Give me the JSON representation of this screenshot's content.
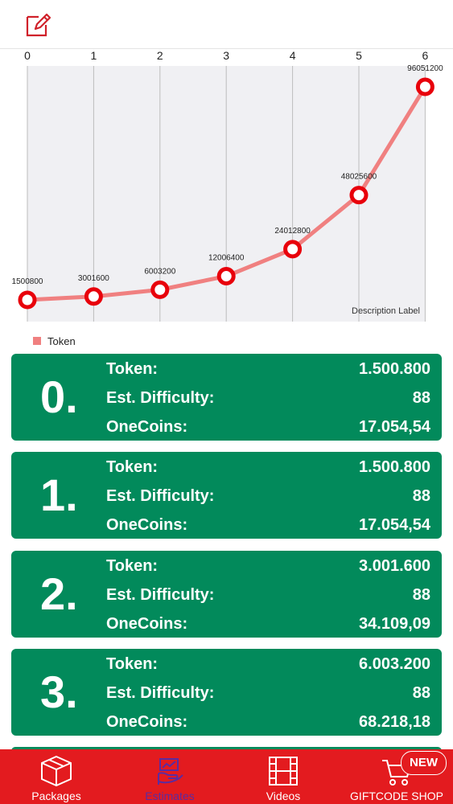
{
  "header": {
    "edit_icon": "edit-icon"
  },
  "chart_data": {
    "type": "line",
    "x": [
      0,
      1,
      2,
      3,
      4,
      5,
      6
    ],
    "series": [
      {
        "name": "Token",
        "values": [
          1500800,
          3001600,
          6003200,
          12006400,
          24012800,
          48025600,
          96051200
        ],
        "point_labels": [
          "1500800",
          "3001600",
          "6003200",
          "12006400",
          "24012800",
          "48025600",
          "96051200"
        ]
      }
    ],
    "tick_labels": [
      "0",
      "1",
      "2",
      "3",
      "4",
      "5",
      "6"
    ],
    "description": "Description Label",
    "legend": "bottom-left",
    "grid": true,
    "colors": {
      "line": "#f08080",
      "marker": "#e8000b"
    }
  },
  "cards": [
    {
      "index": "0.",
      "token_label": "Token:",
      "token": "1.500.800",
      "difficulty_label": "Est. Difficulty:",
      "difficulty": "88",
      "onecoins_label": "OneCoins:",
      "onecoins": "17.054,54"
    },
    {
      "index": "1.",
      "token_label": "Token:",
      "token": "1.500.800",
      "difficulty_label": "Est. Difficulty:",
      "difficulty": "88",
      "onecoins_label": "OneCoins:",
      "onecoins": "17.054,54"
    },
    {
      "index": "2.",
      "token_label": "Token:",
      "token": "3.001.600",
      "difficulty_label": "Est. Difficulty:",
      "difficulty": "88",
      "onecoins_label": "OneCoins:",
      "onecoins": "34.109,09"
    },
    {
      "index": "3.",
      "token_label": "Token:",
      "token": "6.003.200",
      "difficulty_label": "Est. Difficulty:",
      "difficulty": "88",
      "onecoins_label": "OneCoins:",
      "onecoins": "68.218,18"
    }
  ],
  "tabs": [
    {
      "label": "Packages",
      "icon": "package-icon"
    },
    {
      "label": "Estimates",
      "icon": "estimates-icon",
      "active": true
    },
    {
      "label": "Videos",
      "icon": "film-icon"
    },
    {
      "label": "GIFTCODE SHOP",
      "icon": "cart-icon"
    }
  ],
  "badge": {
    "label": "NEW"
  },
  "colors": {
    "accent": "#e31b1f",
    "card": "#028a5b",
    "active_tab": "#5b2ca0"
  }
}
